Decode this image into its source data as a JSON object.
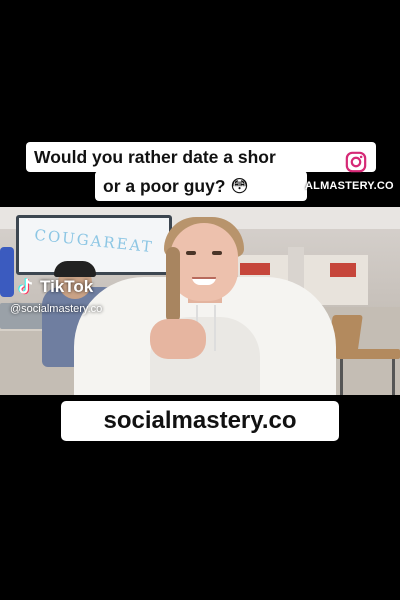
{
  "caption": {
    "line1": "Would you rather date a shor",
    "line2": "or a poor guy? 😳"
  },
  "watermarks": {
    "instagram_icon": "instagram-icon",
    "instagram_handle": "ALMASTERY.CO",
    "tiktok_icon": "tiktok-icon",
    "tiktok_label": "TikTok",
    "tiktok_handle": "@socialmastery.co"
  },
  "scene": {
    "sign_text": "COUGAREAT"
  },
  "footer": {
    "url_text": "socialmastery.co"
  },
  "colors": {
    "background": "#000000",
    "caption_bg": "#ffffff",
    "caption_text": "#111111",
    "instagram_accent": "#d62976",
    "tiktok_cyan": "#25f4ee",
    "tiktok_red": "#fe2c55"
  }
}
